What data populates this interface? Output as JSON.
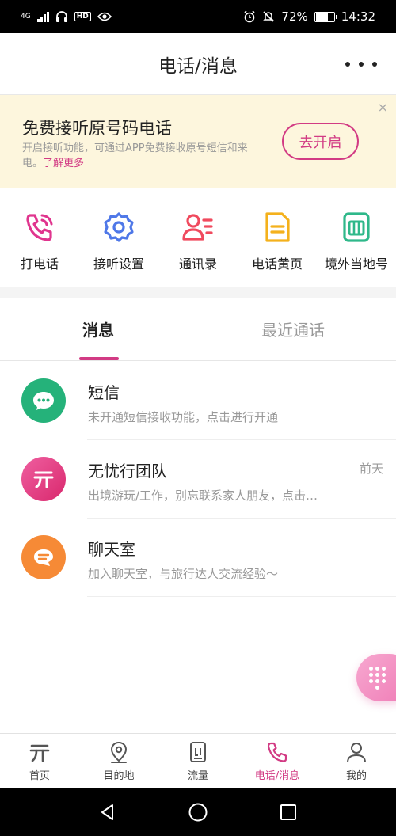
{
  "status_bar": {
    "network": "4G",
    "battery": "72%",
    "battery_level": 0.72,
    "time": "14:32"
  },
  "header": {
    "title": "电话/消息",
    "more_icon": "more-dots-icon"
  },
  "banner": {
    "title": "免费接听原号码电话",
    "desc": "开启接听功能，可通过APP免费接收原号短信和来电。",
    "link": "了解更多",
    "button": "去开启",
    "close": "×"
  },
  "actions": [
    {
      "label": "打电话",
      "icon": "phone-icon",
      "color": "#e0358e"
    },
    {
      "label": "接听设置",
      "icon": "gear-icon",
      "color": "#4f78e8"
    },
    {
      "label": "通讯录",
      "icon": "contacts-icon",
      "color": "#f04a5e"
    },
    {
      "label": "电话黄页",
      "icon": "document-icon",
      "color": "#f4b11c"
    },
    {
      "label": "境外当地号",
      "icon": "sim-card-icon",
      "color": "#2fb88a"
    }
  ],
  "tabs": [
    {
      "label": "消息",
      "active": true
    },
    {
      "label": "最近通话",
      "active": false
    }
  ],
  "messages": [
    {
      "title": "短信",
      "subtitle": "未开通短信接收功能，点击进行开通",
      "time": "",
      "icon": "chat-bubble-icon",
      "color": "#25b27a"
    },
    {
      "title": "无忧行团队",
      "subtitle": "出境游玩/工作，别忘联系家人朋友，点击…",
      "time": "前天",
      "icon": "app-logo-icon",
      "color": "#e2397f"
    },
    {
      "title": "聊天室",
      "subtitle": "加入聊天室，与旅行达人交流经验～",
      "time": "",
      "icon": "chat-room-icon",
      "color": "#f68a36"
    }
  ],
  "fab": {
    "icon": "dialpad-icon"
  },
  "tabbar": [
    {
      "label": "首页",
      "icon": "home-logo-icon",
      "active": false
    },
    {
      "label": "目的地",
      "icon": "location-pin-icon",
      "active": false
    },
    {
      "label": "流量",
      "icon": "data-card-icon",
      "active": false
    },
    {
      "label": "电话/消息",
      "icon": "phone-icon",
      "active": true
    },
    {
      "label": "我的",
      "icon": "person-icon",
      "active": false
    }
  ],
  "colors": {
    "accent": "#d23b84",
    "banner_bg": "#fdf6dd"
  }
}
